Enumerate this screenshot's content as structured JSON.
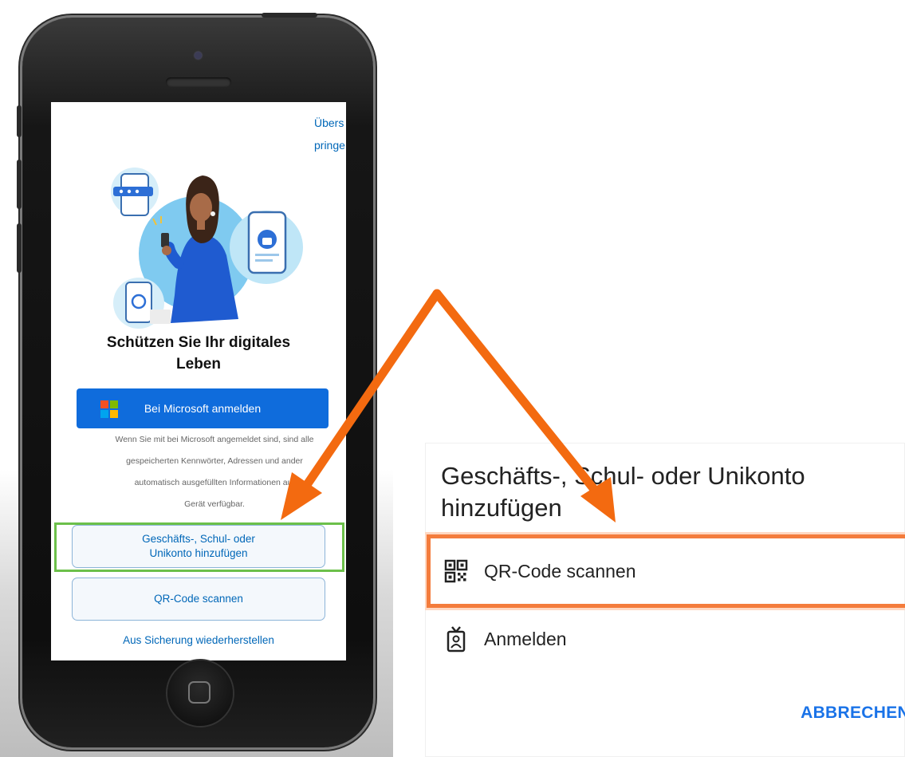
{
  "phone_screen": {
    "top_link_line1": "Übers",
    "top_link_line2": "pringe",
    "title_line1": "Schützen Sie Ihr digitales",
    "title_line2": "Leben",
    "microsoft_signin_label": "Bei Microsoft anmelden",
    "info_lines": [
      "Wenn Sie mit bei Microsoft angemeldet sind, sind alle",
      "gespeicherten Kennwörter, Adressen und ander",
      "automatisch ausgefüllten Informationen auf",
      "Gerät verfügbar."
    ],
    "add_account_line1": "Geschäfts-, Schul- oder",
    "add_account_line2": "Unikonto hinzufügen",
    "scan_qr_label": "QR-Code scannen",
    "restore_label": "Aus Sicherung wiederherstellen"
  },
  "dialog": {
    "title_line1": "Geschäfts-, Schul- oder Unikonto",
    "title_line2": "hinzufügen",
    "options": [
      {
        "label": "QR-Code scannen",
        "icon": "qr-code-icon"
      },
      {
        "label": "Anmelden",
        "icon": "badge-icon"
      }
    ],
    "cancel_label": "ABBRECHEN"
  },
  "colors": {
    "brand_blue": "#0f6cdc",
    "link_blue": "#0067b8",
    "highlight_green": "#6cc04a",
    "highlight_orange": "#f47c3c",
    "arrow_orange": "#f36a10"
  }
}
